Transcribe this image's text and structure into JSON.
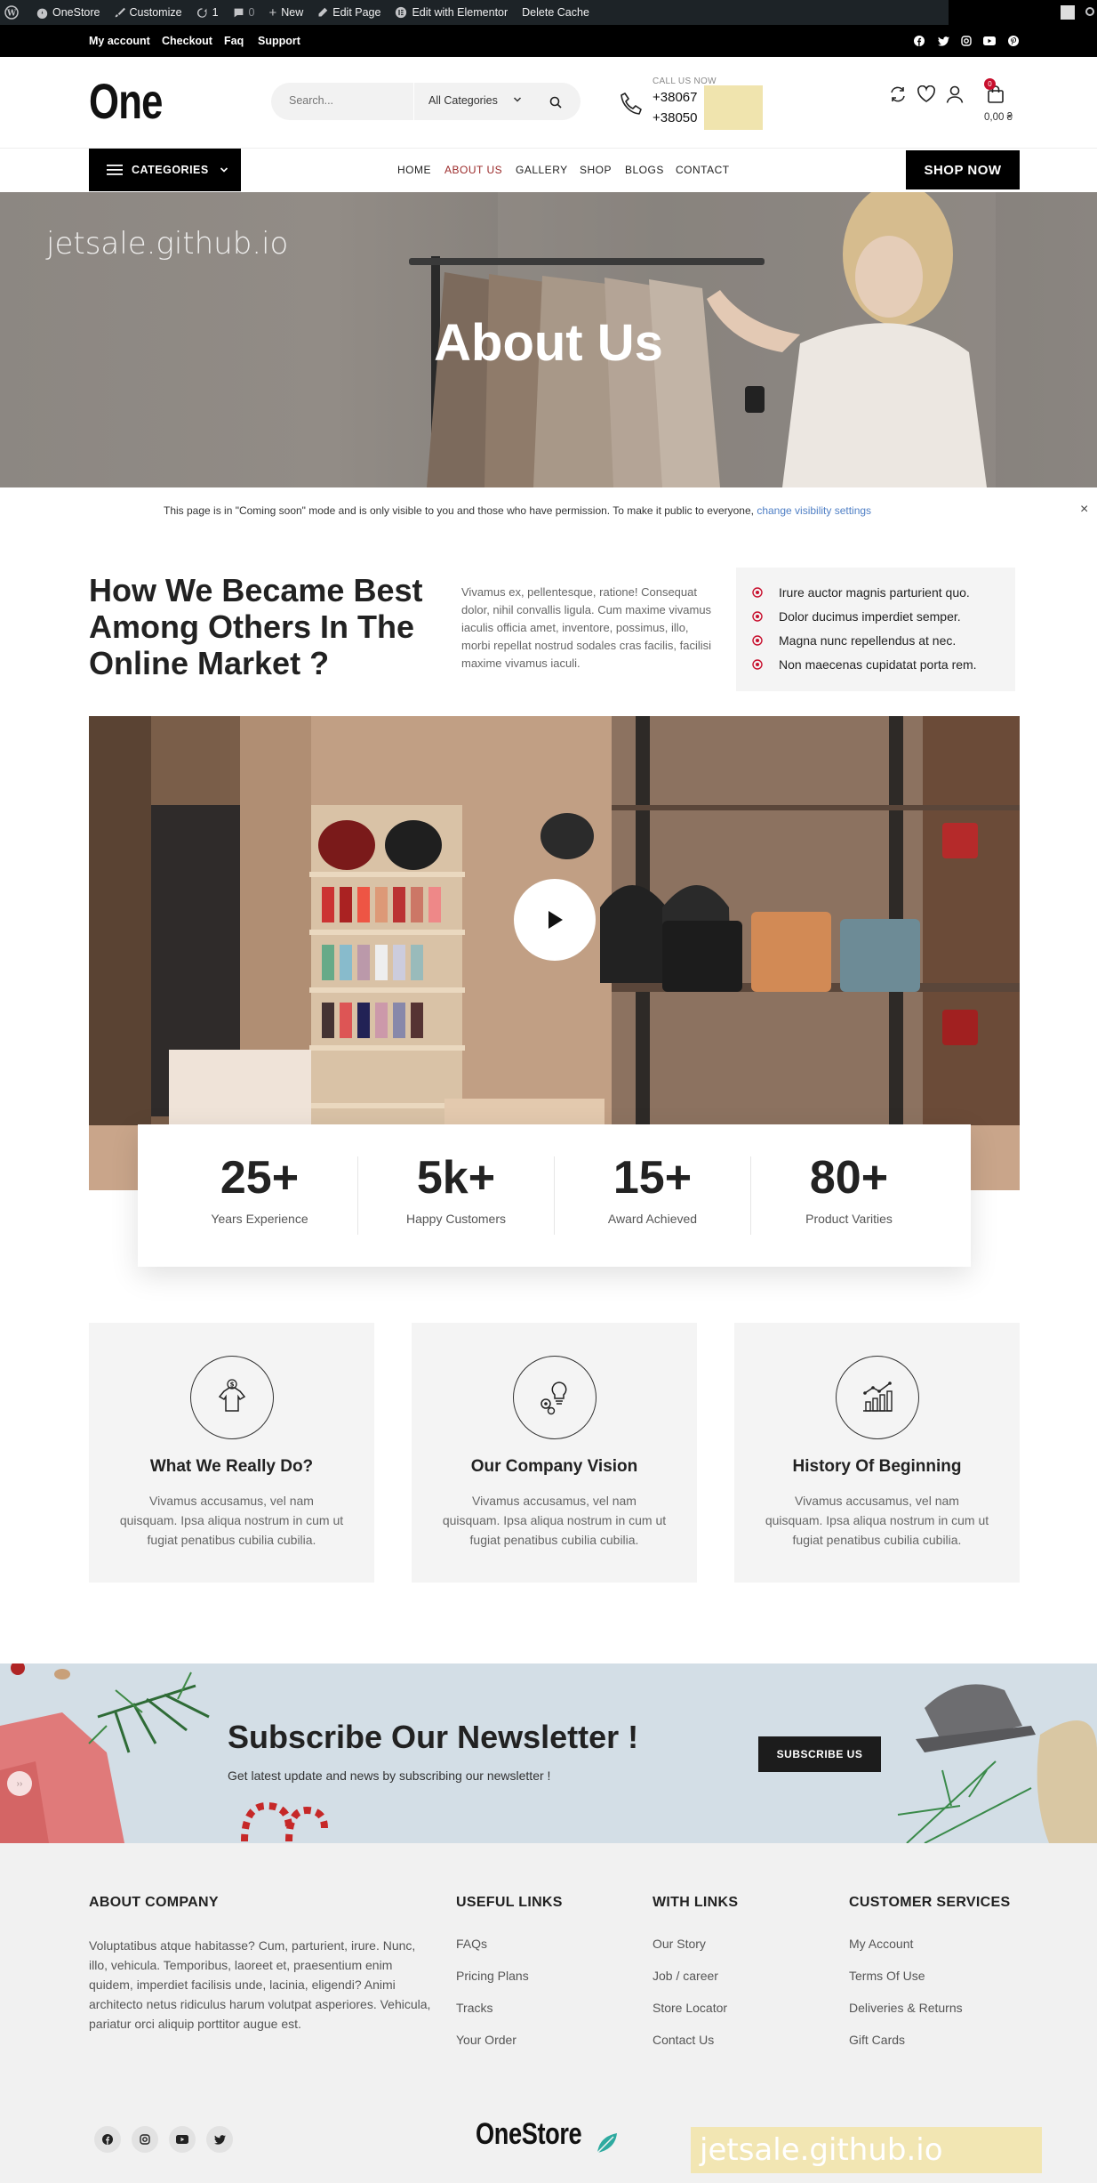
{
  "admin_bar": {
    "items": [
      "OneStore",
      "Customize",
      "1",
      "0",
      "New",
      "Edit Page",
      "Edit with Elementor",
      "Delete Cache"
    ]
  },
  "topbar": {
    "links": [
      "My account",
      "Checkout",
      "Faq",
      "Support"
    ],
    "social_icons": [
      "facebook-icon",
      "twitter-icon",
      "instagram-icon",
      "youtube-icon",
      "pinterest-icon"
    ]
  },
  "header": {
    "logo": "One",
    "search_placeholder": "Search...",
    "category_select": "All Categories",
    "call_label": "CALL US NOW",
    "phone1": "+38067",
    "phone2": "+38050",
    "cart_count": "0",
    "cart_total": "0,00 ₴"
  },
  "nav": {
    "categories_label": "CATEGORIES",
    "items": [
      "HOME",
      "ABOUT US",
      "GALLERY",
      "SHOP",
      "BLOGS",
      "CONTACT"
    ],
    "active": "ABOUT US",
    "shop_now": "SHOP NOW"
  },
  "hero": {
    "watermark": "jetsale.github.io",
    "title": "About Us"
  },
  "notice": {
    "text": "This page is in \"Coming soon\" mode and is only visible to you and those who have permission. To make it public to everyone, ",
    "link": "change visibility settings",
    "close": "×"
  },
  "intro": {
    "heading": "How We Became Best Among Others In The Online Market ?",
    "paragraph": "Vivamus ex, pellentesque, ratione! Consequat dolor, nihil convallis ligula. Cum maxime vivamus iaculis officia amet, inventore, possimus, illo, morbi repellat nostrud sodales cras facilis, facilisi maxime vivamus iaculi.",
    "list": [
      "Irure auctor magnis parturient quo.",
      "Dolor ducimus imperdiet semper.",
      "Magna nunc repellendus at nec.",
      "Non maecenas cupidatat porta rem."
    ]
  },
  "stats": [
    {
      "num": "25+",
      "label": "Years Experience"
    },
    {
      "num": "5k+",
      "label": "Happy Customers"
    },
    {
      "num": "15+",
      "label": "Award Achieved"
    },
    {
      "num": "80+",
      "label": "Product Varities"
    }
  ],
  "features": [
    {
      "title": "What We Really Do?",
      "desc": "Vivamus accusamus, vel nam quisquam. Ipsa aliqua nostrum in cum ut fugiat penatibus cubilia cubilia.",
      "icon": "shirt-dollar-icon"
    },
    {
      "title": "Our Company Vision",
      "desc": "Vivamus accusamus, vel nam quisquam. Ipsa aliqua nostrum in cum ut fugiat penatibus cubilia cubilia.",
      "icon": "bulb-gears-icon"
    },
    {
      "title": "History Of Beginning",
      "desc": "Vivamus accusamus, vel nam quisquam. Ipsa aliqua nostrum in cum ut fugiat penatibus cubilia cubilia.",
      "icon": "growth-chart-icon"
    }
  ],
  "newsletter": {
    "title": "Subscribe Our Newsletter !",
    "desc": "Get latest update and news by subscribing our newsletter !",
    "button": "SUBSCRIBE US"
  },
  "footer": {
    "about_title": "ABOUT COMPANY",
    "about_text": "Voluptatibus atque habitasse? Cum, parturient, irure. Nunc, illo, vehicula. Temporibus, laoreet et, praesentium enim quidem, imperdiet facilisis unde, lacinia, eligendi? Animi architecto netus ridiculus harum volutpat asperiores. Vehicula, pariatur orci aliquip porttitor augue est.",
    "useful_title": "USEFUL LINKS",
    "useful": [
      "FAQs",
      "Pricing Plans",
      "Tracks",
      "Your Order"
    ],
    "with_title": "WITH LINKS",
    "with": [
      "Our Story",
      "Job / career",
      "Store Locator",
      "Contact Us"
    ],
    "cs_title": "CUSTOMER SERVICES",
    "cs": [
      "My Account",
      "Terms Of Use",
      "Deliveries & Returns",
      "Gift Cards"
    ],
    "logo": "OneStore",
    "watermark": "jetsale.github.io"
  },
  "colors": {
    "accent": "#c8102e",
    "active_nav": "#9b2a2a",
    "link": "#4f7fc5"
  }
}
